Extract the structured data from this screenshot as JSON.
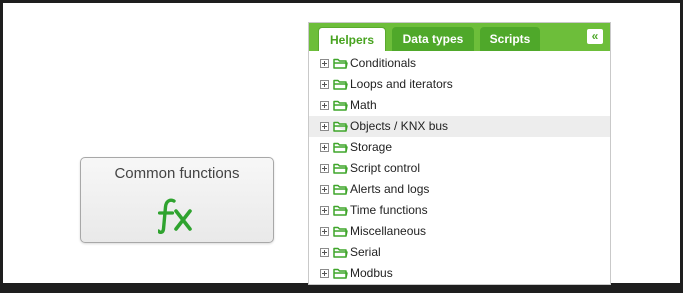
{
  "colors": {
    "accent": "#6dbe3a",
    "accent_dark": "#4fa82a",
    "fx": "#2fa32f",
    "frame": "#1e1e1e"
  },
  "function_button": {
    "label": "Common functions",
    "icon": "fx-icon"
  },
  "panel": {
    "tabs": [
      {
        "label": "Helpers",
        "active": true
      },
      {
        "label": "Data types",
        "active": false
      },
      {
        "label": "Scripts",
        "active": false
      }
    ],
    "collapse_glyph": "«",
    "tree": [
      {
        "label": "Conditionals"
      },
      {
        "label": "Loops and iterators"
      },
      {
        "label": "Math"
      },
      {
        "label": "Objects / KNX bus",
        "highlighted": true
      },
      {
        "label": "Storage"
      },
      {
        "label": "Script control"
      },
      {
        "label": "Alerts and logs"
      },
      {
        "label": "Time functions"
      },
      {
        "label": "Miscellaneous"
      },
      {
        "label": "Serial"
      },
      {
        "label": "Modbus"
      }
    ]
  }
}
